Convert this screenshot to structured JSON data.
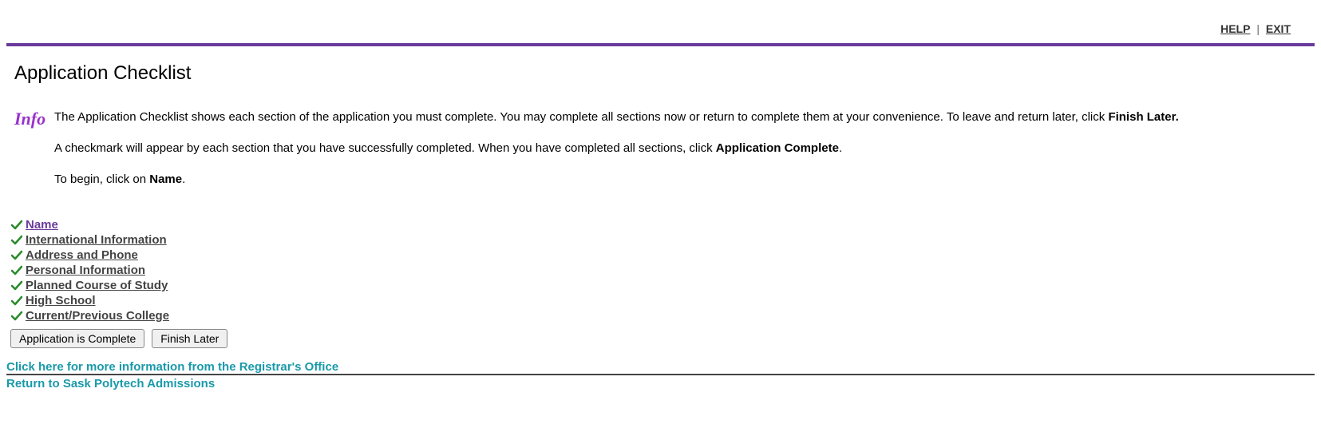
{
  "top_nav": {
    "help": "HELP",
    "exit": "EXIT",
    "sep": "|"
  },
  "page_title": "Application Checklist",
  "info_label": "Info",
  "info": {
    "p1_a": "The Application Checklist shows each section of the application you must complete. You may complete all sections now or return to complete them at your convenience. To leave and return later, click ",
    "p1_b": "Finish Later.",
    "p2_a": "A checkmark will appear by each section that you have successfully completed. When you have completed all sections, click ",
    "p2_b": "Application Complete",
    "p2_c": ".",
    "p3_a": "To begin, click on ",
    "p3_b": "Name",
    "p3_c": "."
  },
  "checklist": [
    {
      "label": "Name",
      "visited": true
    },
    {
      "label": "International Information",
      "visited": false
    },
    {
      "label": "Address and Phone",
      "visited": false
    },
    {
      "label": "Personal Information",
      "visited": false
    },
    {
      "label": "Planned Course of Study",
      "visited": false
    },
    {
      "label": "High School",
      "visited": false
    },
    {
      "label": "Current/Previous College",
      "visited": false
    }
  ],
  "buttons": {
    "complete": "Application is Complete",
    "finish_later": "Finish Later"
  },
  "footer": {
    "registrar": "Click here for more information from the Registrar's Office",
    "return": "Return to Sask Polytech Admissions"
  }
}
